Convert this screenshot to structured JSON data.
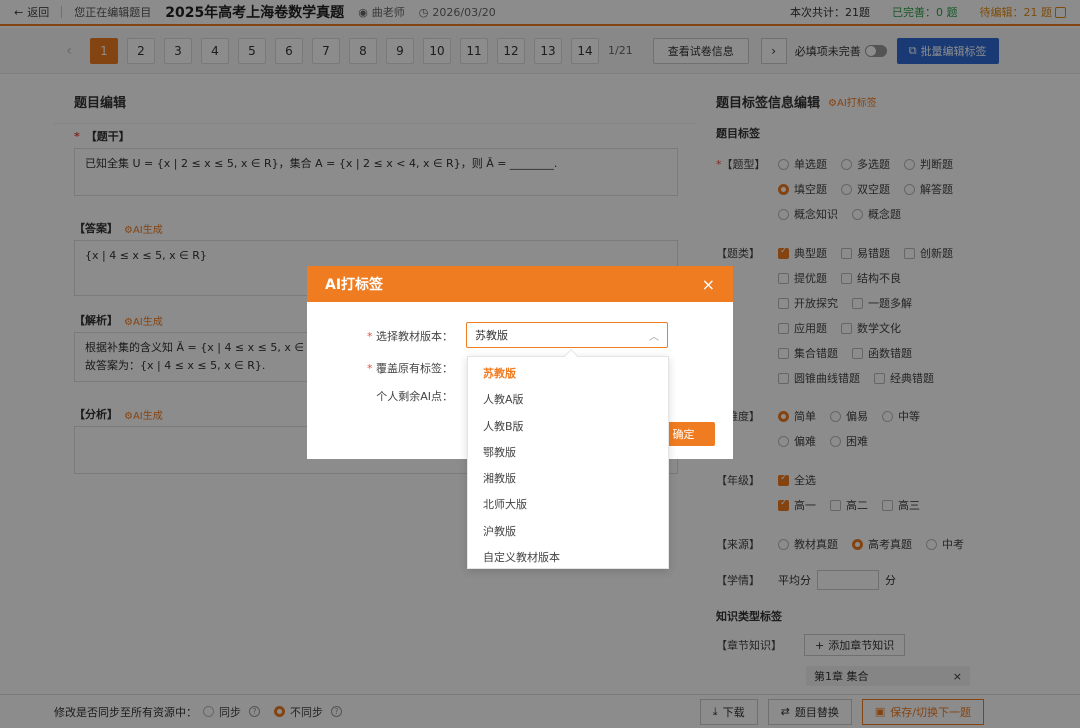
{
  "topbar": {
    "back_label": "返回",
    "editing_label": "您正在编辑题目",
    "title": "2025年高考上海卷数学真题",
    "author": "曲老师",
    "date": "2026/03/20",
    "total_label": "本次共计：21题",
    "done_label": "已完善：0 题",
    "pending_label": "待编辑：21 题"
  },
  "pager": {
    "pages": [
      "1",
      "2",
      "3",
      "4",
      "5",
      "6",
      "7",
      "8",
      "9",
      "10",
      "11",
      "12",
      "13",
      "14"
    ],
    "total": "1/21",
    "view_info": "查看试卷信息",
    "required_incomplete": "必填项未完善",
    "batch_edit": "批量编辑标签"
  },
  "left": {
    "title": "题目编辑",
    "stem_label": "【题干】",
    "stem_text": "已知全集 U = {x | 2 ≤ x ≤ 5, x ∈ R}，集合 A = {x | 2 ≤ x < 4, x ∈ R}，则 Ā = ________.",
    "answer_label": "【答案】",
    "answer_text": "{x | 4 ≤ x ≤ 5, x ∈ R}",
    "analysis_label": "【解析】",
    "analysis_line1": "根据补集的含义知 Ā = {x | 4 ≤ x ≤ 5, x ∈ R}.",
    "analysis_line2": "故答案为：{x | 4 ≤ x ≤ 5, x ∈ R}.",
    "fenxi_label": "【分析】",
    "ai_label": "AI生成"
  },
  "right": {
    "title": "题目标签信息编辑",
    "ai_tag": "AI打标签",
    "tags_heading": "题目标签",
    "qtype_label": "【题型】",
    "qtypes": [
      "单选题",
      "多选题",
      "判断题",
      "填空题",
      "双空题",
      "解答题",
      "概念知识",
      "概念题"
    ],
    "qclass_label": "【题类】",
    "qclasses": [
      "典型题",
      "易错题",
      "创新题",
      "提优题",
      "结构不良",
      "开放探究",
      "一题多解",
      "应用题",
      "数学文化",
      "集合错题",
      "函数错题",
      "圆锥曲线错题",
      "经典错题"
    ],
    "difficulty_label": "【难度】",
    "difficulties": [
      "简单",
      "偏易",
      "中等",
      "偏难",
      "困难"
    ],
    "grade_label": "【年级】",
    "grade_all": "全选",
    "grades": [
      "高一",
      "高二",
      "高三"
    ],
    "source_label": "【来源】",
    "sources": [
      "教材真题",
      "高考真题",
      "中考"
    ],
    "score_label": "【学情】",
    "score_avg": "平均分",
    "score_unit": "分",
    "knowledge_heading": "知识类型标签",
    "chapter_label": "【章节知识】",
    "add_chapter": "添加章节知识",
    "chapter_item": "第1章 集合"
  },
  "bottom": {
    "sync_question": "修改是否同步至所有资源中：",
    "sync": "同步",
    "no_sync": "不同步",
    "download": "下载",
    "replace": "题目替换",
    "save_next": "保存/切换下一题"
  },
  "modal": {
    "title": "AI打标签",
    "close": "×",
    "edition_label": "选择教材版本：",
    "edition_value": "苏教版",
    "overwrite_label": "覆盖原有标签：",
    "remaining_label": "个人剩余AI点：",
    "confirm": "确定"
  },
  "dropdown": {
    "options": [
      "苏教版",
      "人教A版",
      "人教B版",
      "鄂教版",
      "湘教版",
      "北师大版",
      "沪教版",
      "自定义教材版本"
    ],
    "selected_index": 0
  },
  "colors": {
    "accent": "#f07c22",
    "blue": "#2f6bd6",
    "green": "#2aa146"
  }
}
